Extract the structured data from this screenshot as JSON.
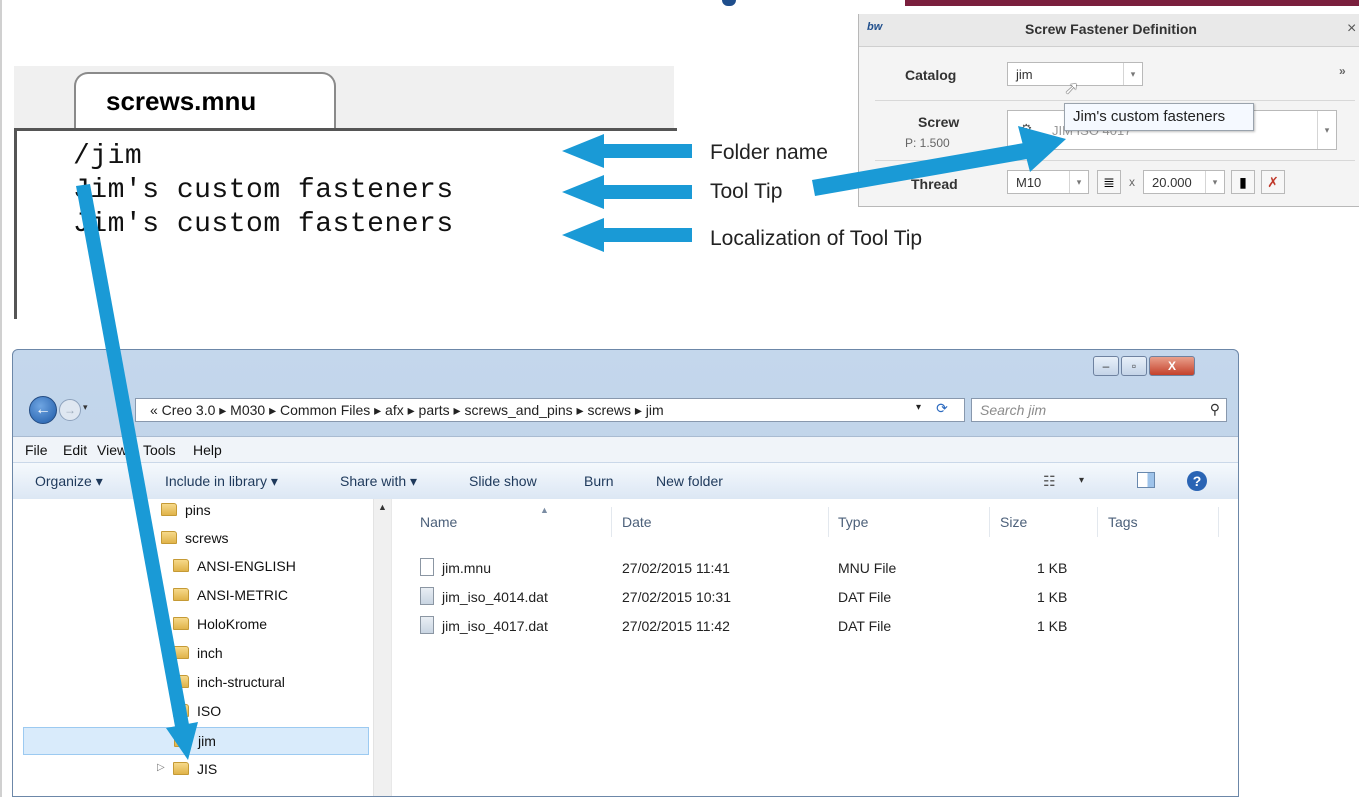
{
  "mnu_file": {
    "tab_label": "screws.mnu",
    "lines": [
      "/jim",
      "Jim's custom fasteners",
      "Jim's custom fasteners"
    ]
  },
  "annotations": {
    "folder_name": "Folder name",
    "tool_tip": "Tool Tip",
    "localization": "Localization of Tool Tip"
  },
  "dialog": {
    "app_icon": "bw",
    "title": "Screw Fastener Definition",
    "close": "×",
    "catalog_label": "Catalog",
    "catalog_value": "jim",
    "more": "»",
    "screw_label": "Screw",
    "screw_value": "JIM ISO 4017",
    "pitch": "P: 1.500",
    "thread_label": "Thread",
    "thread_value": "M10",
    "times": "x",
    "length_value": "20.000",
    "tooltip": "Jim's custom fasteners"
  },
  "explorer": {
    "address_path": "« Creo 3.0 ▸ M030 ▸ Common Files ▸ afx ▸ parts ▸ screws_and_pins ▸ screws ▸ jim",
    "search_placeholder": "Search jim",
    "menu": [
      "File",
      "Edit",
      "View",
      "Tools",
      "Help"
    ],
    "commands": {
      "organize": "Organize ▾",
      "include": "Include in library ▾",
      "share": "Share with ▾",
      "slideshow": "Slide show",
      "burn": "Burn",
      "new_folder": "New folder"
    },
    "tree": {
      "pins": "pins",
      "screws": "screws",
      "ansi_english": "ANSI-ENGLISH",
      "ansi_metric": "ANSI-METRIC",
      "holokrome": "HoloKrome",
      "inch": "inch",
      "inch_structural": "inch-structural",
      "iso": "ISO",
      "jim": "jim",
      "jis": "JIS"
    },
    "columns": [
      "Name",
      "Date",
      "Type",
      "Size",
      "Tags"
    ],
    "files": [
      {
        "name": "jim.mnu",
        "date": "27/02/2015 11:41",
        "type": "MNU File",
        "size": "1 KB"
      },
      {
        "name": "jim_iso_4014.dat",
        "date": "27/02/2015 10:31",
        "type": "DAT File",
        "size": "1 KB"
      },
      {
        "name": "jim_iso_4017.dat",
        "date": "27/02/2015 11:42",
        "type": "DAT File",
        "size": "1 KB"
      }
    ]
  },
  "colors": {
    "arrow": "#1a9ad6",
    "explorer_frame": "#c4d7ec",
    "selection": "#d9ebfb"
  }
}
